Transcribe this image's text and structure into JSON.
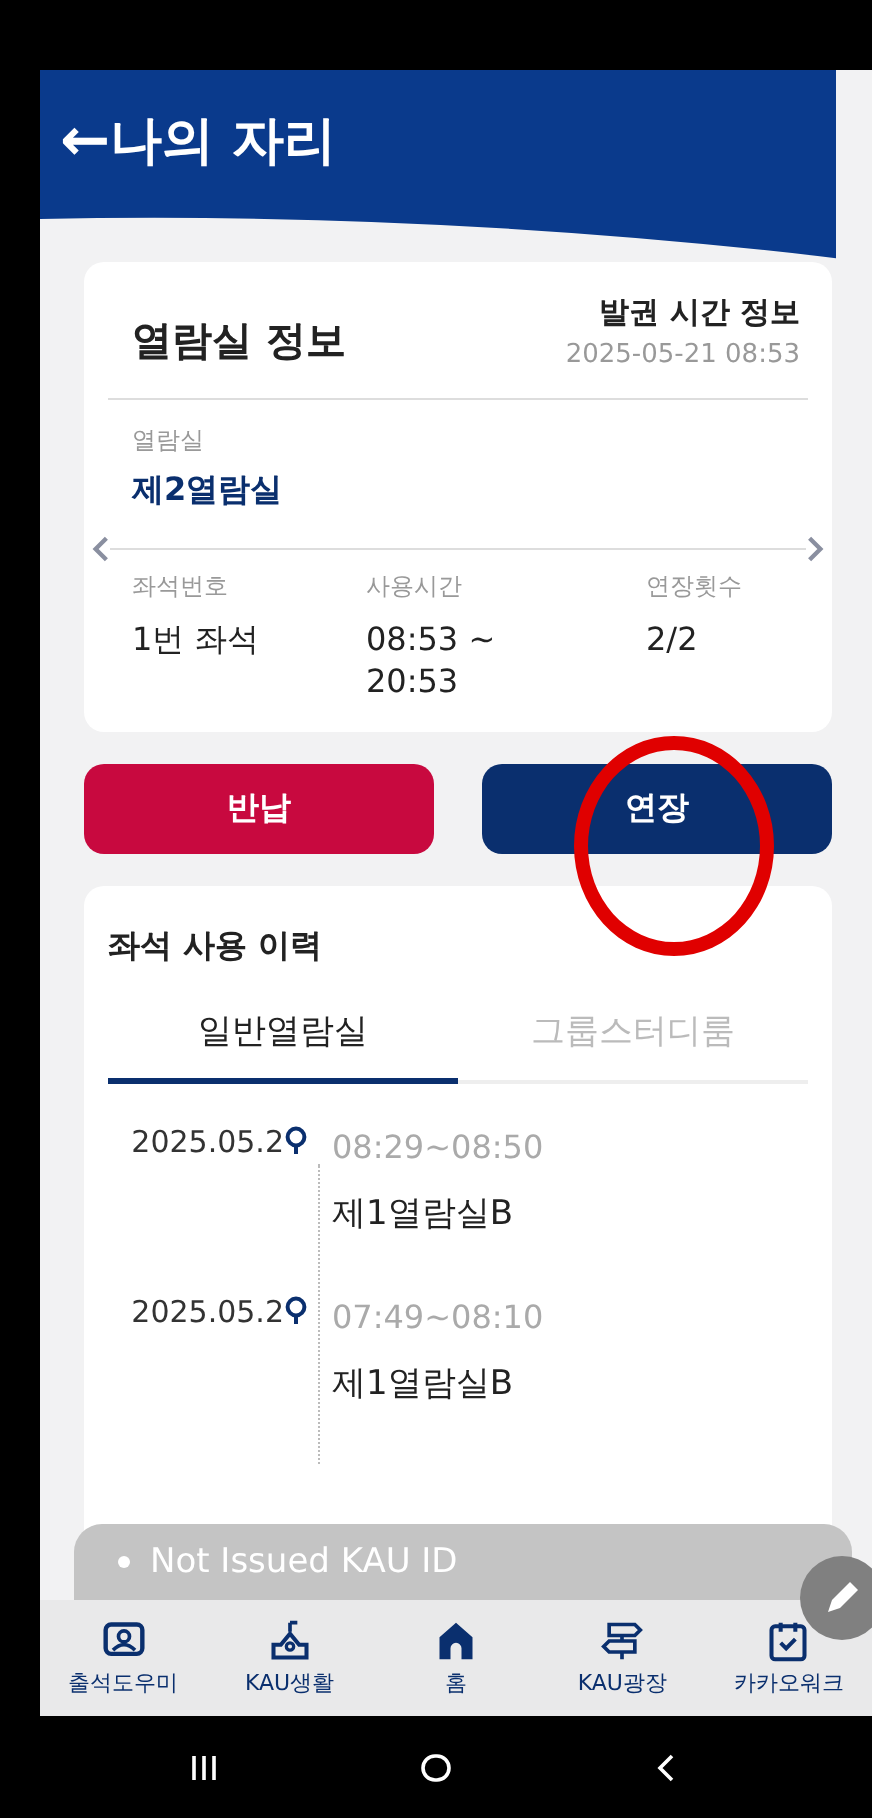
{
  "header": {
    "back": "←",
    "title": "나의 자리"
  },
  "seat_card": {
    "title": "열람실 정보",
    "issue_label": "발권 시간 정보",
    "issue_time": "2025-05-21 08:53",
    "room_label": "열람실",
    "room": "제2열람실",
    "fields": [
      {
        "label": "좌석번호",
        "value": "1번 좌석"
      },
      {
        "label": "사용시간",
        "value": "08:53 ~ 20:53"
      },
      {
        "label": "연장횟수",
        "value": "2/2"
      }
    ]
  },
  "actions": [
    {
      "kind": "return",
      "label": "반납"
    },
    {
      "kind": "extend",
      "label": "연장"
    }
  ],
  "history": {
    "title": "좌석 사용 이력",
    "tabs": [
      {
        "label": "일반열람실",
        "selected": true
      },
      {
        "label": "그룹스터디룸",
        "selected": false
      }
    ],
    "entries": [
      {
        "date": "2025.05.2",
        "time": "08:29~08:50",
        "room": "제1열람실B"
      },
      {
        "date": "2025.05.2",
        "time": "07:49~08:10",
        "room": "제1열람실B"
      }
    ]
  },
  "toast": "Not Issued KAU ID",
  "nav": [
    {
      "kind": "attendance",
      "label": "출석도우미"
    },
    {
      "kind": "campus",
      "label": "KAU생활"
    },
    {
      "kind": "home",
      "label": "홈"
    },
    {
      "kind": "plaza",
      "label": "KAU광장"
    },
    {
      "kind": "work",
      "label": "카카오워크"
    }
  ]
}
